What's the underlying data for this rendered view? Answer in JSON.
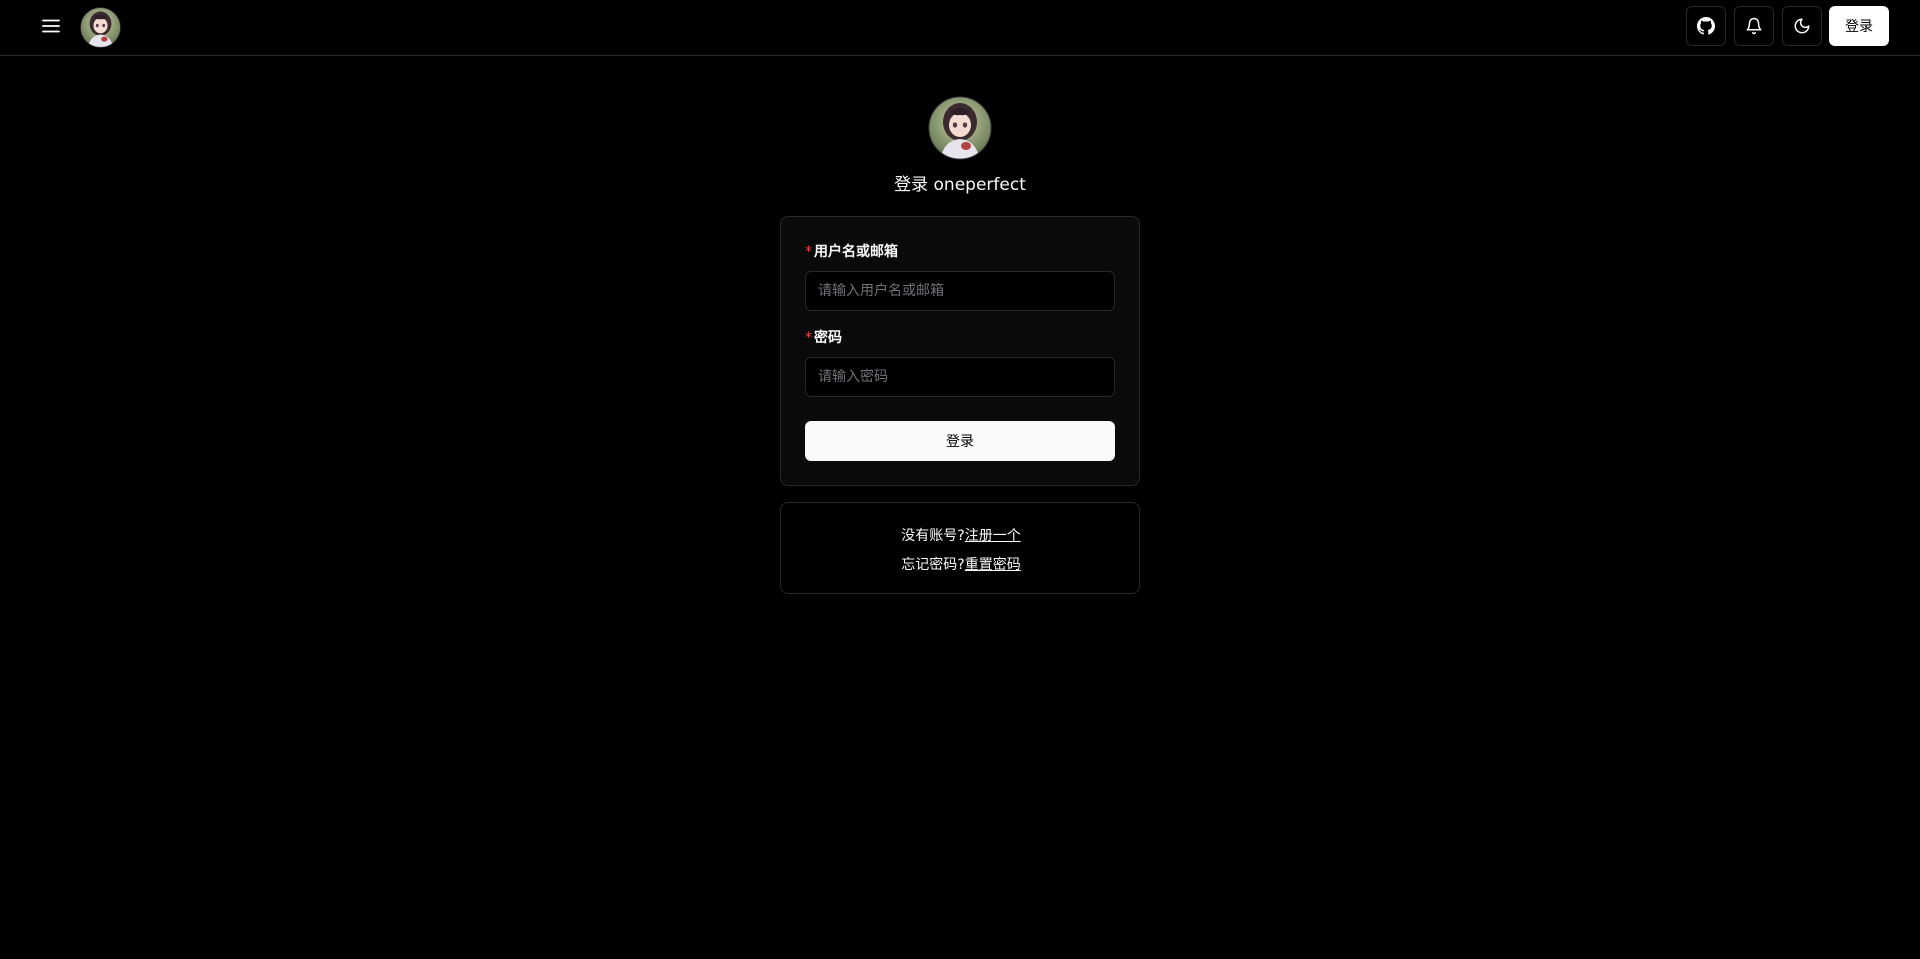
{
  "header": {
    "menu_icon": "hamburger-menu-icon",
    "github_icon": "github-icon",
    "bell_icon": "bell-icon",
    "moon_icon": "moon-icon",
    "login_label": "登录"
  },
  "hero": {
    "title": "登录 oneperfect"
  },
  "form": {
    "username_label": "用户名或邮箱",
    "username_placeholder": "请输入用户名或邮箱",
    "username_value": "",
    "password_label": "密码",
    "password_placeholder": "请输入密码",
    "password_value": "",
    "required_mark": "*",
    "submit_label": "登录"
  },
  "footer_links": {
    "no_account_text": "没有账号?",
    "register_link": "注册一个",
    "forgot_text": "忘记密码?",
    "reset_link": "重置密码"
  },
  "colors": {
    "background": "#000000",
    "border": "#27272a",
    "required": "#ef4444",
    "primary_button": "#fafafa"
  }
}
